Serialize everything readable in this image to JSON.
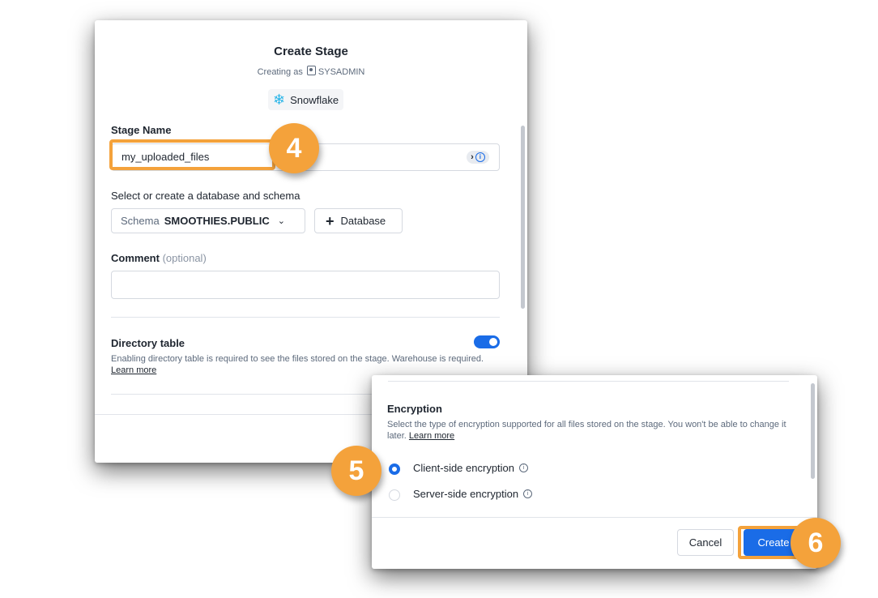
{
  "dialog": {
    "title": "Create Stage",
    "creating_as_prefix": "Creating as",
    "role": "SYSADMIN",
    "source": "Snowflake"
  },
  "stage_name": {
    "label": "Stage Name",
    "value": "my_uploaded_files",
    "icon": "arrow-info-icon"
  },
  "database": {
    "label": "Select or create a database and schema",
    "schema_key": "Schema",
    "schema_value": "SMOOTHIES.PUBLIC",
    "add_database_label": "Database"
  },
  "comment": {
    "label": "Comment",
    "optional": "(optional)",
    "value": ""
  },
  "directory_table": {
    "label": "Directory table",
    "description": "Enabling directory table is required to see the files stored on the stage. Warehouse is required.",
    "learn_more": "Learn more",
    "enabled": true
  },
  "encryption": {
    "label": "Encryption",
    "description": "Select the type of encryption supported for all files stored on the stage. You won't be able to change it later.",
    "learn_more": "Learn more",
    "options": [
      {
        "label": "Client-side encryption",
        "selected": true
      },
      {
        "label": "Server-side encryption",
        "selected": false
      }
    ]
  },
  "actions": {
    "cancel": "Cancel",
    "create": "Create"
  },
  "callouts": {
    "step4": "4",
    "step5": "5",
    "step6": "6",
    "color": "#f4a23b"
  },
  "colors": {
    "accent": "#1a6ce7",
    "snowflake": "#29b5e8"
  }
}
